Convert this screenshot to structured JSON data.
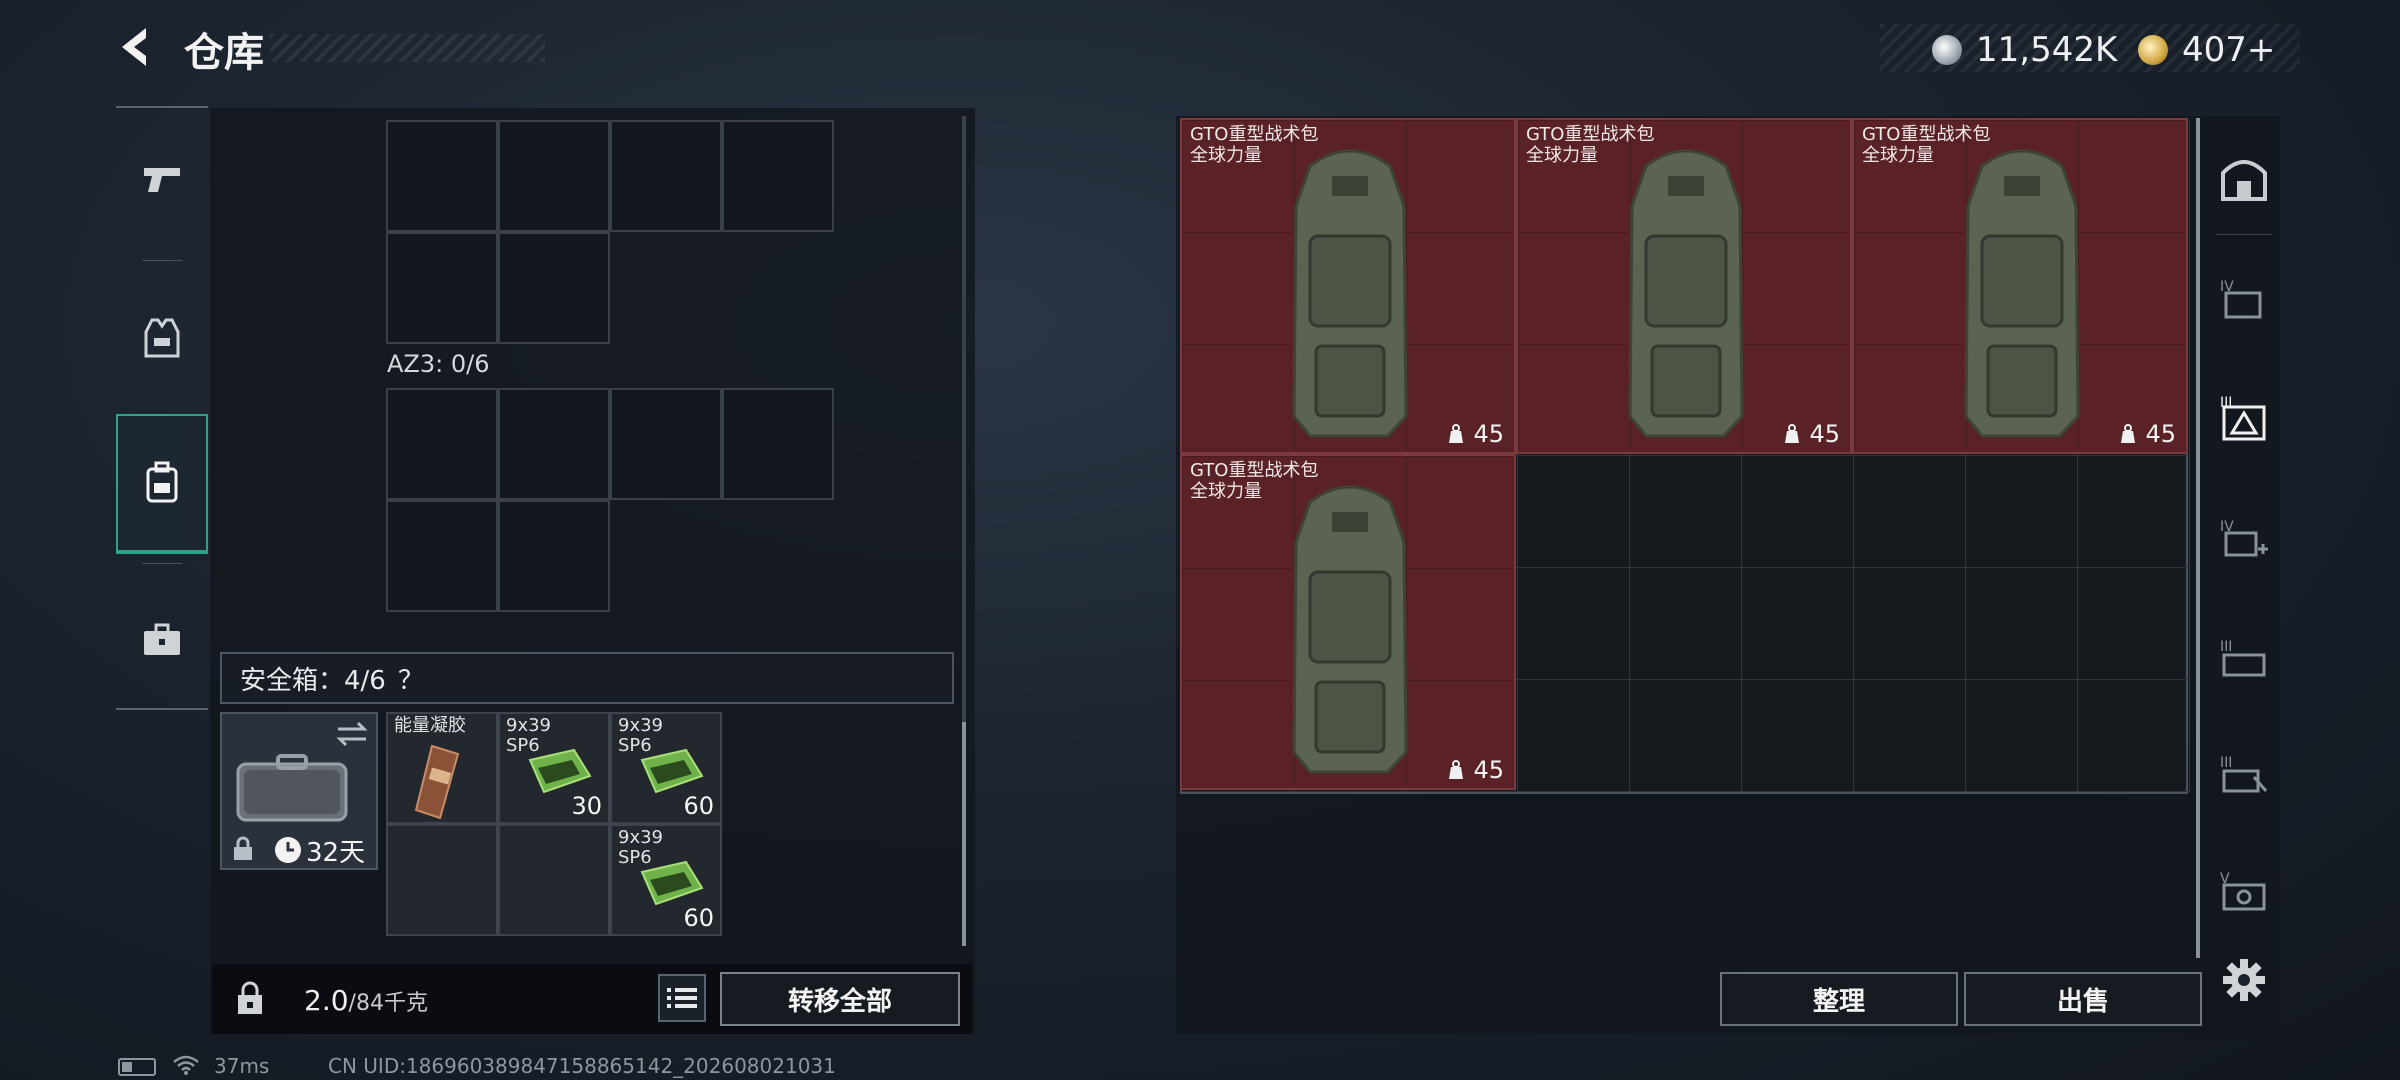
{
  "header": {
    "title": "仓库",
    "back_icon": "back-arrow-icon",
    "currency": {
      "silver": "11,542K",
      "gold": "407+"
    }
  },
  "rail": {
    "items": [
      {
        "name": "weapons",
        "icon": "pistol-icon",
        "active": false
      },
      {
        "name": "armor",
        "icon": "vest-icon",
        "active": false
      },
      {
        "name": "backpacks",
        "icon": "backpack-icon",
        "active": true
      },
      {
        "name": "cases",
        "icon": "briefcase-icon",
        "active": false
      }
    ]
  },
  "storage": {
    "az3_label": "AZ3: 0/6",
    "safe_box": {
      "label": "安全箱：4/6",
      "help": "？",
      "timer": "32天",
      "items": [
        {
          "name": "能量凝胶",
          "count": ""
        },
        {
          "name": "9x39\nSP6",
          "count": "30"
        },
        {
          "name": "9x39\nSP6",
          "count": "60"
        },
        {
          "name": "9x39\nSP6",
          "count": "60"
        }
      ]
    },
    "weight_value": "2.0",
    "weight_max": "/84千克",
    "transfer_all": "转移全部"
  },
  "right": {
    "packs": [
      {
        "name": "GTO重型战术包",
        "sub": "全球力量",
        "capacity": "45"
      },
      {
        "name": "GTO重型战术包",
        "sub": "全球力量",
        "capacity": "45"
      },
      {
        "name": "GTO重型战术包",
        "sub": "全球力量",
        "capacity": "45"
      },
      {
        "name": "GTO重型战术包",
        "sub": "全球力量",
        "capacity": "45"
      }
    ],
    "sort_label": "整理",
    "sell_label": "出售",
    "side_labels": [
      "IV",
      "III",
      "IV",
      "III",
      "III",
      "V"
    ]
  },
  "status": {
    "ping": "37ms",
    "uid": "CN UID:186960389847158865142_202608021031"
  },
  "colors": {
    "accent": "#2fa38a",
    "pack_tile": "#5a2226"
  }
}
